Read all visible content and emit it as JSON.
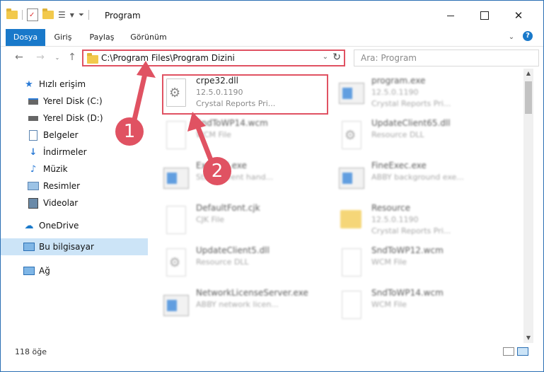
{
  "window": {
    "title": "Program",
    "minimize_icon": "minimize-icon",
    "maximize_icon": "maximize-icon",
    "close_icon": "close-icon"
  },
  "ribbon": {
    "tabs": [
      {
        "label": "Dosya",
        "active": true
      },
      {
        "label": "Giriş",
        "active": false
      },
      {
        "label": "Paylaş",
        "active": false
      },
      {
        "label": "Görünüm",
        "active": false
      }
    ],
    "help": "?"
  },
  "address": {
    "path": "C:\\Program Files\\Program Dizini",
    "search_placeholder": "Ara: Program"
  },
  "sidebar": {
    "items": [
      {
        "label": "Hızlı erişim",
        "icon": "star-icon",
        "pinned": false
      },
      {
        "label": "Yerel Disk (C:)",
        "icon": "drive-icon",
        "pinned": false
      },
      {
        "label": "Yerel Disk (D:)",
        "icon": "drive-icon",
        "pinned": false
      },
      {
        "label": "Belgeler",
        "icon": "documents-icon",
        "pinned": false
      },
      {
        "label": "İndirmeler",
        "icon": "download-icon",
        "pinned": true
      },
      {
        "label": "Müzik",
        "icon": "music-icon",
        "pinned": true
      },
      {
        "label": "Resimler",
        "icon": "pictures-icon",
        "pinned": true
      },
      {
        "label": "Videolar",
        "icon": "video-icon",
        "pinned": true
      },
      {
        "label": "OneDrive",
        "icon": "cloud-icon",
        "pinned": false
      },
      {
        "label": "Bu bilgisayar",
        "icon": "computer-icon",
        "pinned": false
      },
      {
        "label": "Ağ",
        "icon": "network-icon",
        "pinned": false
      }
    ]
  },
  "files": [
    {
      "name": "crpe32.dll",
      "line2": "12.5.0.1190",
      "line3": "Crystal Reports Pri...",
      "kind": "dll",
      "highlighted": true
    },
    {
      "name": "program.exe",
      "line2": "12.5.0.1190",
      "line3": "Crystal Reports Pri...",
      "kind": "exe"
    },
    {
      "name": "SndToWP14.wcm",
      "line2": "WCM File",
      "line3": "",
      "kind": "doc"
    },
    {
      "name": "UpdateClient65.dll",
      "line2": "Resource DLL",
      "line3": "",
      "kind": "dll"
    },
    {
      "name": "ExecuTI.exe",
      "line2": "Starts event hand...",
      "line3": "",
      "kind": "app"
    },
    {
      "name": "FineExec.exe",
      "line2": "ABBY background exe...",
      "line3": "",
      "kind": "app"
    },
    {
      "name": "DefaultFont.cjk",
      "line2": "CJK File",
      "line3": "",
      "kind": "doc"
    },
    {
      "name": "Resource",
      "line2": "12.5.0.1190",
      "line3": "Crystal Reports Pri...",
      "kind": "folder"
    },
    {
      "name": "UpdateClient5.dll",
      "line2": "Resource DLL",
      "line3": "",
      "kind": "dll"
    },
    {
      "name": "SndToWP12.wcm",
      "line2": "WCM File",
      "line3": "",
      "kind": "doc"
    },
    {
      "name": "NetworkLicenseServer.exe",
      "line2": "ABBY network licen...",
      "line3": "",
      "kind": "app"
    },
    {
      "name": "SndToWP14.wcm",
      "line2": "WCM File",
      "line3": "",
      "kind": "doc"
    }
  ],
  "status": {
    "count": "118 öğe"
  },
  "callouts": [
    "1",
    "2"
  ],
  "colors": {
    "accent": "#1979ca",
    "highlight": "#e05262",
    "selection": "#cce4f7"
  }
}
